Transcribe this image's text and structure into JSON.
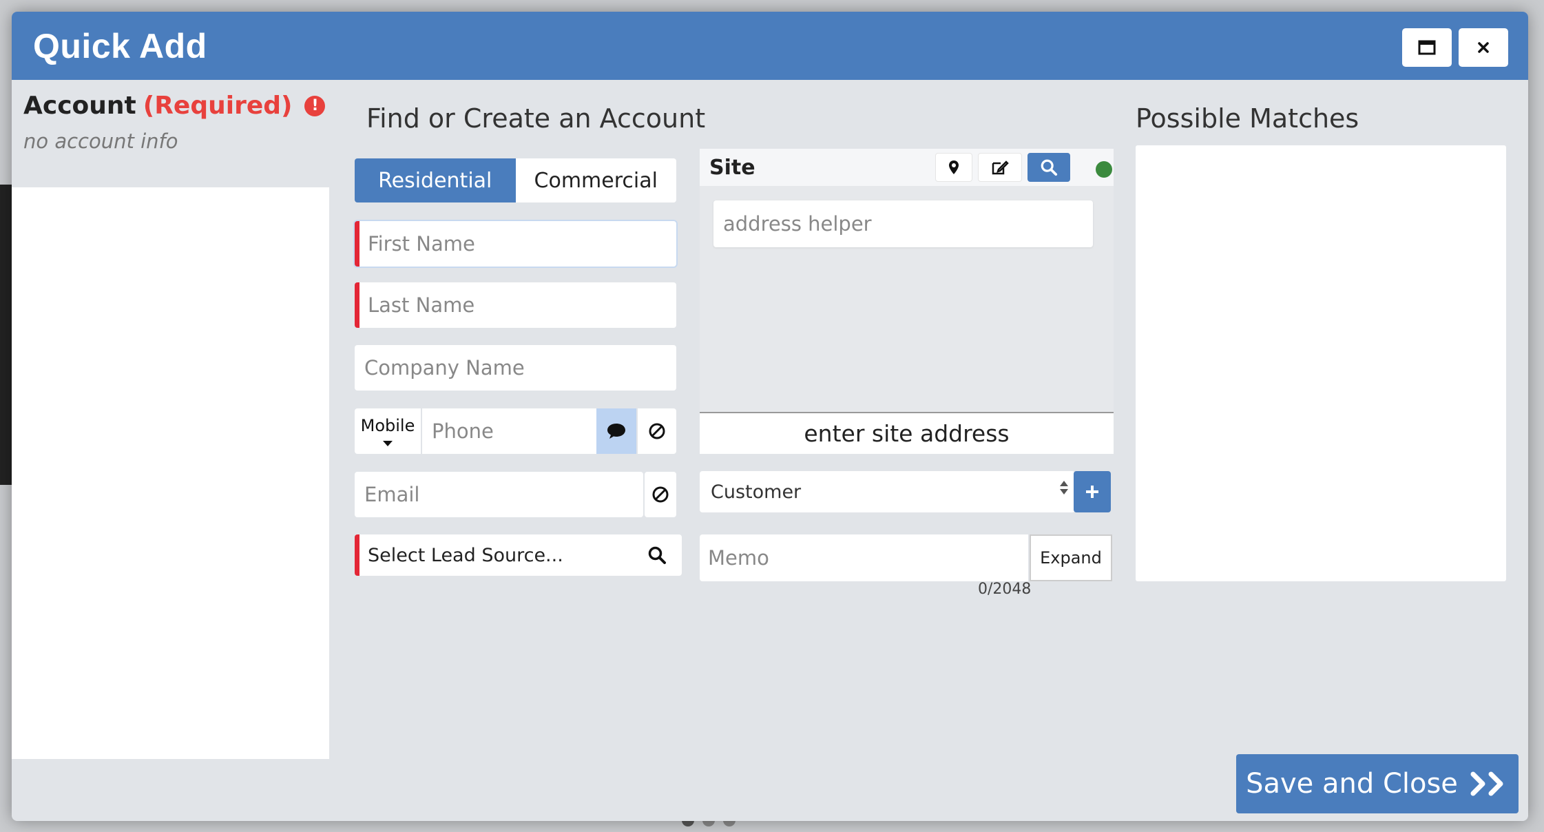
{
  "modal": {
    "title": "Quick Add"
  },
  "account": {
    "label": "Account",
    "required": "(Required)",
    "info": "no account info"
  },
  "find": {
    "title": "Find or Create an Account",
    "toggle": {
      "residential": "Residential",
      "commercial": "Commercial",
      "selected": "Residential"
    },
    "fields": {
      "first_name": "First Name",
      "last_name": "Last Name",
      "company_name": "Company Name",
      "phone_type": "Mobile",
      "phone": "Phone",
      "email": "Email",
      "lead_source": "Select Lead Source..."
    }
  },
  "site": {
    "title": "Site",
    "address_helper": "address helper",
    "enter_address": "enter site address",
    "status_color": "#3b8a3e",
    "account_type": "Customer",
    "memo_placeholder": "Memo",
    "expand_label": "Expand",
    "memo_count": "0/2048"
  },
  "matches": {
    "title": "Possible Matches"
  },
  "footer": {
    "save_label": "Save and Close"
  },
  "colors": {
    "primary": "#4a7dbd",
    "required": "#e32636",
    "alert": "#e8413d"
  }
}
